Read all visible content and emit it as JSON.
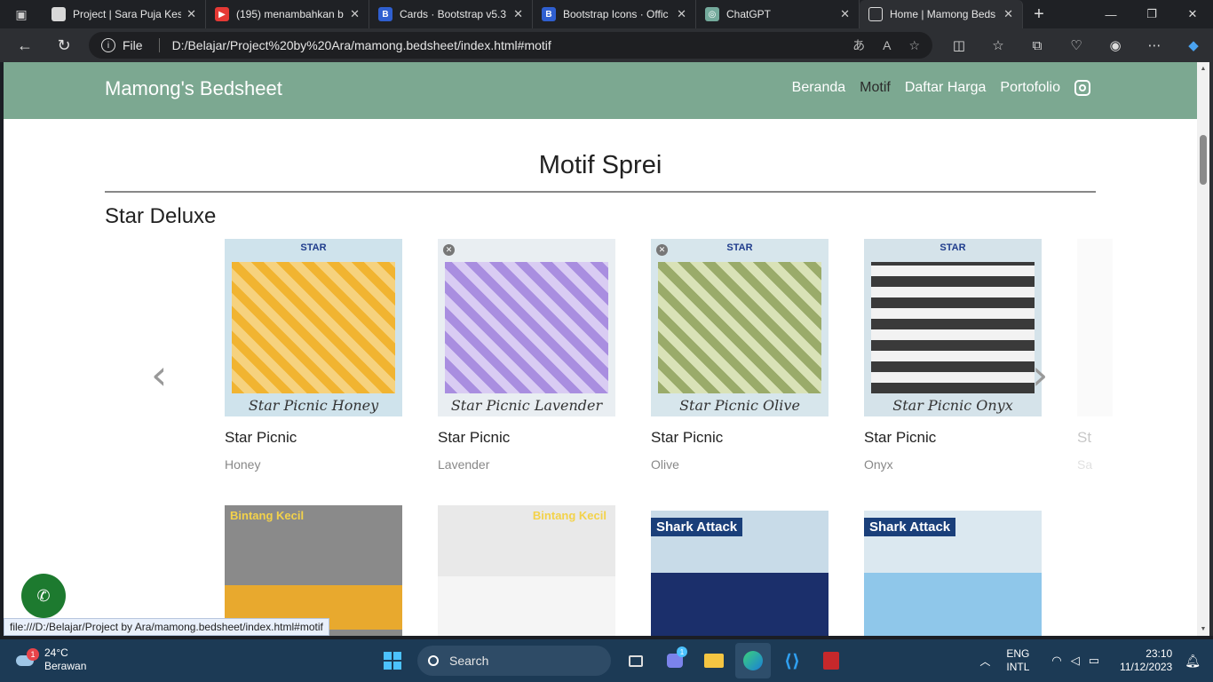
{
  "browser": {
    "tabs": [
      {
        "label": "Project | Sara Puja Kes",
        "favicon": "#d8d8d8",
        "fav_text": ""
      },
      {
        "label": "(195) menambahkan b",
        "favicon": "#e53935",
        "fav_text": "▶"
      },
      {
        "label": "Cards · Bootstrap v5.3",
        "favicon": "#7952b3",
        "fav_text": "B"
      },
      {
        "label": "Bootstrap Icons · Offic",
        "favicon": "#7952b3",
        "fav_text": "B"
      },
      {
        "label": "ChatGPT",
        "favicon": "#74aa9c",
        "fav_text": "◎"
      },
      {
        "label": "Home | Mamong Beds",
        "favicon": "#d8d8d8",
        "fav_text": ""
      }
    ],
    "omnibox": {
      "scheme_label": "File",
      "url": "D:/Belajar/Project%20by%20Ara/mamong.bedsheet/index.html#motif"
    },
    "status_url": "file:///D:/Belajar/Project by Ara/mamong.bedsheet/index.html#motif"
  },
  "site": {
    "brand": "Mamong's Bedsheet",
    "nav": [
      "Beranda",
      "Motif",
      "Daftar Harga",
      "Portofolio"
    ],
    "active_nav": "Motif",
    "section_title": "Motif Sprei",
    "category": "Star Deluxe",
    "cards": [
      {
        "title": "Star Picnic",
        "subtitle": "Honey",
        "logo": "STAR",
        "script": "Star Picnic Honey",
        "color": "#f1b431",
        "check": "#f6d27e"
      },
      {
        "title": "Star Picnic",
        "subtitle": "Lavender",
        "logo": "",
        "script": "Star Picnic Lavender",
        "color": "#a98ee0",
        "check": "#d9ccf3"
      },
      {
        "title": "Star Picnic",
        "subtitle": "Olive",
        "logo": "STAR",
        "script": "Star Picnic Olive",
        "color": "#9aab6a",
        "check": "#d9e2b7"
      },
      {
        "title": "Star Picnic",
        "subtitle": "Onyx",
        "logo": "STAR",
        "script": "Star Picnic Onyx",
        "color": "#3a3a3a",
        "check": "#f2f2f2"
      },
      {
        "title": "St",
        "subtitle": "Sa"
      }
    ],
    "cards_row2": [
      {
        "banner": "Bintang Kecil",
        "color": "#e8a92e"
      },
      {
        "banner": "Bintang Kecil",
        "color": "#cfd8cf"
      },
      {
        "banner": "Shark Attack",
        "color": "#1b2f6b"
      },
      {
        "banner": "Shark Attack",
        "color": "#8fc7ea"
      }
    ]
  },
  "taskbar": {
    "weather_temp": "24°C",
    "weather_desc": "Berawan",
    "weather_badge": "1",
    "search_label": "Search",
    "teams_badge": "1",
    "lang_top": "ENG",
    "lang_bottom": "INTL",
    "time": "23:10",
    "date": "11/12/2023"
  },
  "colors": {
    "nav_bg": "#7ca891",
    "whatsapp": "#1d7a2f",
    "taskbar": "#1c3a55"
  }
}
